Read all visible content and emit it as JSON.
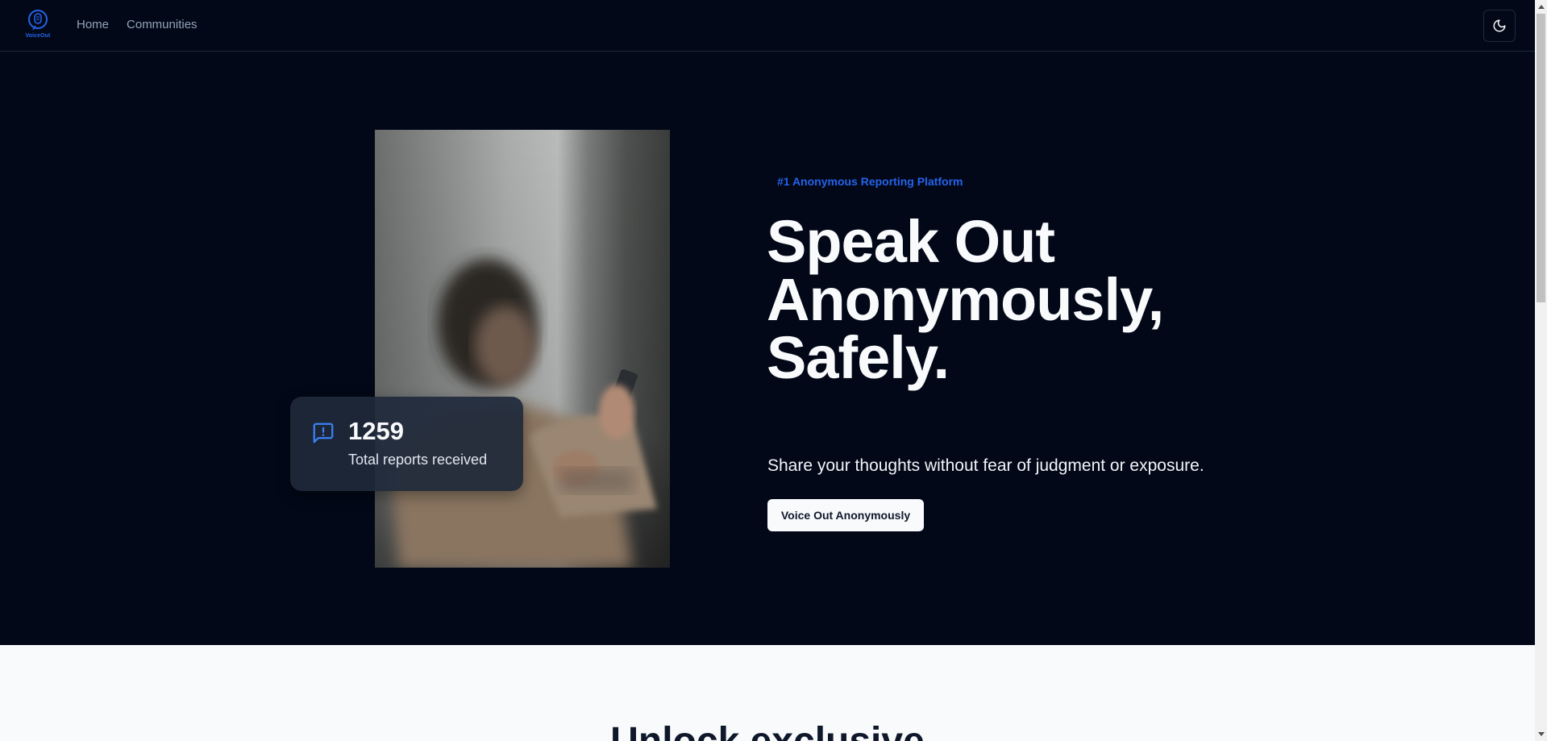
{
  "header": {
    "logo_text": "VoiceOut",
    "nav": [
      "Home",
      "Communities"
    ],
    "theme_toggle_icon": "moon-icon"
  },
  "hero": {
    "tagline": "#1 Anonymous Reporting Platform",
    "headline": "Speak Out Anonymously, Safely.",
    "subtitle": "Share your thoughts without fear of judgment or exposure.",
    "cta_label": "Voice Out Anonymously",
    "stat": {
      "icon": "message-alert-icon",
      "value": "1259",
      "label": "Total reports received"
    }
  },
  "lower": {
    "heading": "Unlock exclusive"
  },
  "colors": {
    "background": "#020817",
    "accent": "#2563eb",
    "text": "#f8fafc",
    "lower_background": "#f8fafc"
  }
}
